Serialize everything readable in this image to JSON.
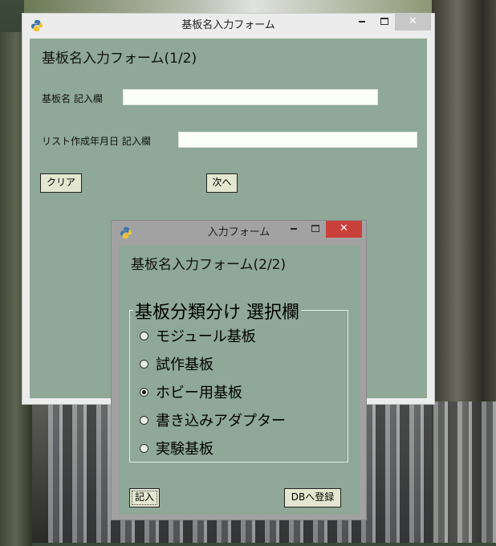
{
  "main_window": {
    "title": "基板名入力フォーム",
    "heading": "基板名入力フォーム(1/2)",
    "board_name_label": "基板名 記入欄",
    "board_name_value": "",
    "list_date_label": "リスト作成年月日 記入欄",
    "list_date_value": "",
    "clear_label": "クリア",
    "next_label": "次へ"
  },
  "dialog": {
    "title": "入力フォーム",
    "heading": "基板名入力フォーム(2/2)",
    "group_title": "基板分類分け  選択欄",
    "options": [
      {
        "label": "モジュール基板",
        "selected": false
      },
      {
        "label": "試作基板",
        "selected": false
      },
      {
        "label": "ホビー用基板",
        "selected": true
      },
      {
        "label": "書き込みアダプター",
        "selected": false
      },
      {
        "label": "実験基板",
        "selected": false
      }
    ],
    "enter_label": "記入",
    "register_label": "DBへ登録"
  },
  "colors": {
    "client_bg": "#8fa897",
    "close_active": "#c9403a",
    "close_inactive": "#c7c7c7"
  },
  "icons": {
    "app_icon": "python-icon",
    "minimize": "minimize-icon",
    "maximize": "maximize-icon",
    "close": "close-icon"
  }
}
